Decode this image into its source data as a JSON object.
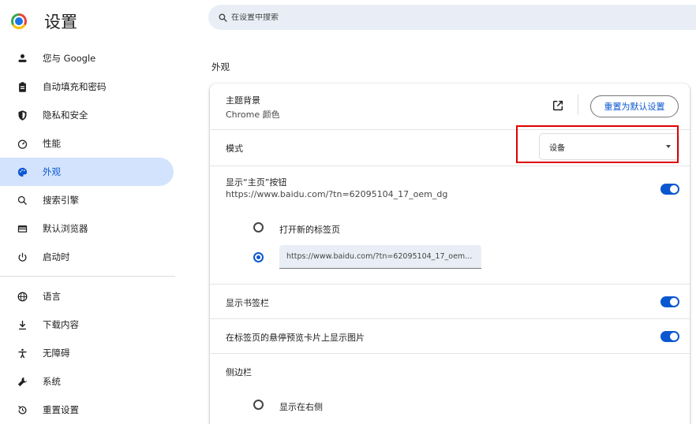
{
  "header": {
    "title": "设置",
    "search_placeholder": "在设置中搜索"
  },
  "sidebar": {
    "items": [
      {
        "label": "您与 Google",
        "icon": "person-icon"
      },
      {
        "label": "自动填充和密码",
        "icon": "clipboard-icon"
      },
      {
        "label": "隐私和安全",
        "icon": "shield-icon"
      },
      {
        "label": "性能",
        "icon": "gauge-icon"
      },
      {
        "label": "外观",
        "icon": "palette-icon",
        "active": true
      },
      {
        "label": "搜索引擎",
        "icon": "search-icon"
      },
      {
        "label": "默认浏览器",
        "icon": "browser-icon"
      },
      {
        "label": "启动时",
        "icon": "power-icon"
      },
      {
        "label": "语言",
        "icon": "globe-icon"
      },
      {
        "label": "下载内容",
        "icon": "download-icon"
      },
      {
        "label": "无障碍",
        "icon": "accessibility-icon"
      },
      {
        "label": "系统",
        "icon": "wrench-icon"
      },
      {
        "label": "重置设置",
        "icon": "reset-icon"
      }
    ]
  },
  "main": {
    "section_title": "外观",
    "theme": {
      "label": "主题背景",
      "value": "Chrome 颜色",
      "reset_label": "重置为默认设置"
    },
    "mode": {
      "label": "模式",
      "selected": "设备"
    },
    "home_button": {
      "label": "显示“主页”按钮",
      "url": "https://www.baidu.com/?tn=62095104_17_oem_dg",
      "enabled": true,
      "option_new_tab": "打开新的标签页",
      "custom_url_value": "https://www.baidu.com/?tn=62095104_17_oem..."
    },
    "bookmarks_bar": {
      "label": "显示书签栏",
      "enabled": true
    },
    "tab_hover": {
      "label": "在标签页的悬停预览卡片上显示图片",
      "enabled": true
    },
    "side_panel": {
      "label": "侧边栏",
      "option_right": "显示在右侧"
    }
  },
  "colors": {
    "accent": "#0b57d0",
    "active_nav_bg": "#d3e3fd",
    "search_bg": "#e9eef6",
    "highlight": "#e00000"
  }
}
